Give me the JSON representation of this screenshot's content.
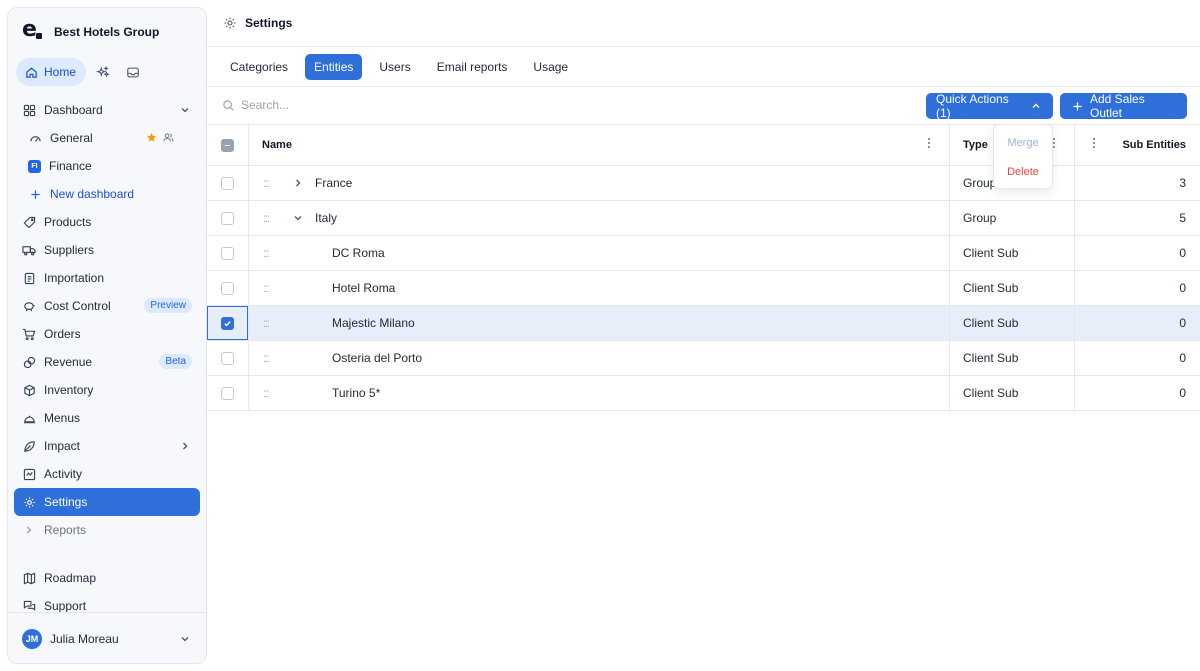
{
  "brand": {
    "name": "Best Hotels Group"
  },
  "top_nav": {
    "home_label": "Home"
  },
  "sidebar": {
    "items": [
      {
        "label": "Dashboard"
      },
      {
        "label": "General"
      },
      {
        "label": "Finance",
        "badge": "FI"
      },
      {
        "label": "New dashboard"
      },
      {
        "label": "Products"
      },
      {
        "label": "Suppliers"
      },
      {
        "label": "Importation"
      },
      {
        "label": "Cost Control",
        "badge": "Preview"
      },
      {
        "label": "Orders"
      },
      {
        "label": "Revenue",
        "badge": "Beta"
      },
      {
        "label": "Inventory"
      },
      {
        "label": "Menus"
      },
      {
        "label": "Impact"
      },
      {
        "label": "Activity"
      },
      {
        "label": "Settings"
      },
      {
        "label": "Reports"
      },
      {
        "label": "Roadmap"
      },
      {
        "label": "Support"
      }
    ]
  },
  "user": {
    "initials": "JM",
    "name": "Julia Moreau"
  },
  "header": {
    "title": "Settings"
  },
  "tabs": [
    {
      "label": "Categories"
    },
    {
      "label": "Entities"
    },
    {
      "label": "Users"
    },
    {
      "label": "Email reports"
    },
    {
      "label": "Usage"
    }
  ],
  "toolbar": {
    "search_placeholder": "Search...",
    "quick_actions_label": "Quick Actions (1)",
    "add_label": "Add Sales Outlet"
  },
  "dropdown": {
    "merge": "Merge",
    "delete": "Delete"
  },
  "table": {
    "columns": {
      "name": "Name",
      "type": "Type",
      "sub": "Sub Entities"
    },
    "rows": [
      {
        "name": "France",
        "type": "Group",
        "sub": "3"
      },
      {
        "name": "Italy",
        "type": "Group",
        "sub": "5"
      },
      {
        "name": "DC Roma",
        "type": "Client Sub",
        "sub": "0"
      },
      {
        "name": "Hotel Roma",
        "type": "Client Sub",
        "sub": "0"
      },
      {
        "name": "Majestic Milano",
        "type": "Client Sub",
        "sub": "0"
      },
      {
        "name": "Osteria del Porto",
        "type": "Client Sub",
        "sub": "0"
      },
      {
        "name": "Turino 5*",
        "type": "Client Sub",
        "sub": "0"
      }
    ]
  },
  "colors": {
    "accent": "#2f6fd9",
    "sidebar_bg": "#f6f8fb",
    "delete": "#ef4444"
  }
}
